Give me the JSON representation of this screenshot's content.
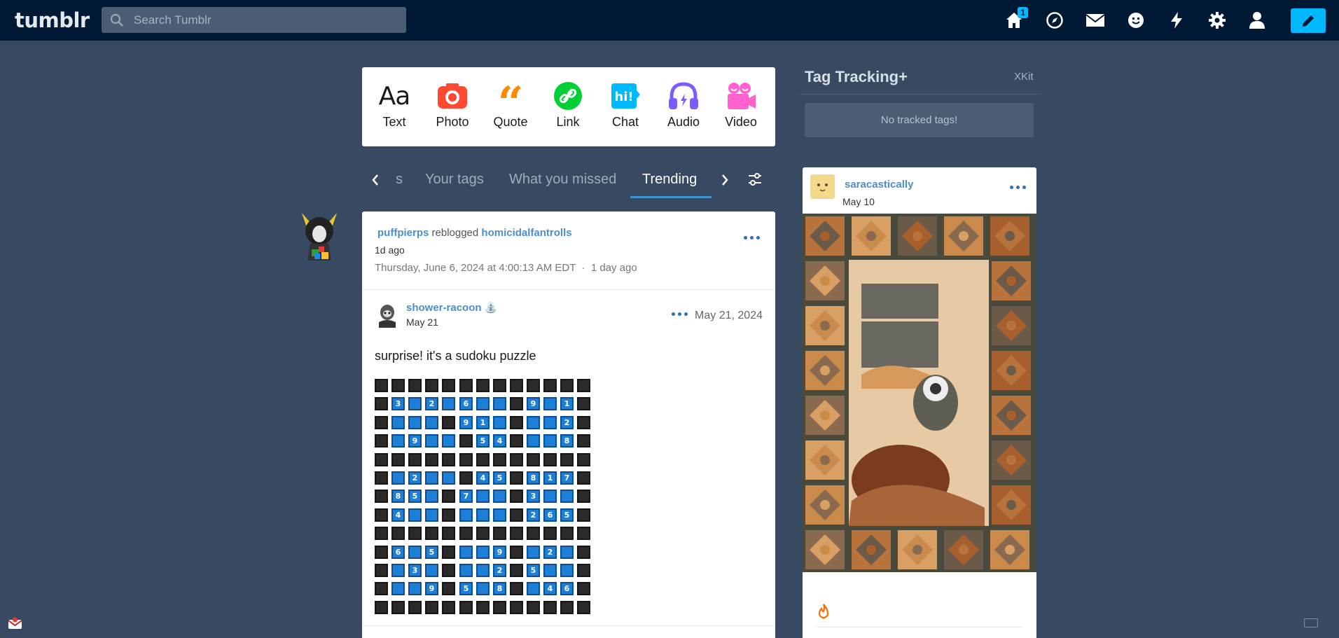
{
  "topbar": {
    "logo": "tumblr",
    "search_placeholder": "Search Tumblr",
    "home_badge": "1",
    "icons": [
      "home-icon",
      "explore-icon",
      "mail-icon",
      "chat-face-icon",
      "activity-icon",
      "settings-icon",
      "account-icon",
      "compose-pencil-icon"
    ]
  },
  "post_types": [
    {
      "label": "Text",
      "icon": "text-icon",
      "color": "#1a1a1a"
    },
    {
      "label": "Photo",
      "icon": "camera-icon",
      "color": "#ff4930"
    },
    {
      "label": "Quote",
      "icon": "quote-icon",
      "color": "#ff8a00"
    },
    {
      "label": "Link",
      "icon": "link-icon",
      "color": "#00cf35"
    },
    {
      "label": "Chat",
      "icon": "chat-icon",
      "color": "#00b8ff"
    },
    {
      "label": "Audio",
      "icon": "headphones-icon",
      "color": "#7c5cff"
    },
    {
      "label": "Video",
      "icon": "video-icon",
      "color": "#ff62ce"
    }
  ],
  "feed_tabs": {
    "partial": "s",
    "items": [
      "Your tags",
      "What you missed",
      "Trending"
    ],
    "active": "Trending"
  },
  "post": {
    "reblogger": "puffpierps",
    "reblogged_text": "reblogged",
    "original": "homicidalfantrolls",
    "ago": "1d ago",
    "timestamp": "Thursday, June 6, 2024 at 4:00:13 AM EDT",
    "separator": "·",
    "relative": "1 day ago",
    "sub": {
      "name": "shower-racoon",
      "date": "May 21",
      "full_date": "May 21, 2024",
      "text": "surprise! it's a sudoku puzzle"
    },
    "sudoku_rows": [
      "-------------",
      "-3b2b6bb-9b1-",
      "-bbb-91b-bb2-",
      "-b9bb-54-bb8-",
      "-------------",
      "-b2bb-45-817-",
      "-85b-7bb-3bb-",
      "-4bb-bbb-265-",
      "-------------",
      "-6b5-bb9-b2b-",
      "-b3b-bb2-5bb-",
      "-bb9-5b8-b46-",
      "-------------"
    ]
  },
  "sidebar": {
    "title": "Tag Tracking+",
    "xkit": "XKit",
    "empty": "No tracked tags!",
    "card": {
      "name": "saracastically",
      "date": "May 10"
    }
  },
  "colors": {
    "background": "#374a62",
    "topbar": "#001935",
    "accent": "#00b8ff",
    "link": "#4b8ec8"
  }
}
